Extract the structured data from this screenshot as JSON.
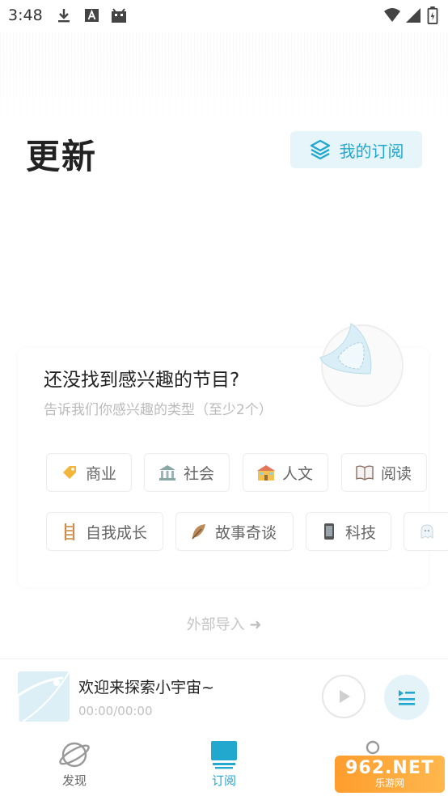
{
  "status_bar": {
    "time": "3:48",
    "left_icons": [
      "download-icon",
      "a-badge-icon",
      "android-icon"
    ],
    "right_icons": [
      "wifi-icon",
      "signal-icon",
      "battery-icon"
    ]
  },
  "header": {
    "title": "更新",
    "my_subscriptions_label": "我的订阅",
    "my_subscriptions_icon": "layers-icon"
  },
  "empty_state": {
    "title": "还没找到感兴趣的节目?",
    "subtitle": "告诉我们你感兴趣的类型（至少2个）",
    "illustration": "planet-icon"
  },
  "categories": [
    {
      "label": "商业",
      "icon": "price-tag-icon"
    },
    {
      "label": "社会",
      "icon": "classical-building-icon"
    },
    {
      "label": "人文",
      "icon": "school-icon"
    },
    {
      "label": "阅读",
      "icon": "open-book-icon"
    },
    {
      "label": "自我成长",
      "icon": "ladder-icon"
    },
    {
      "label": "故事奇谈",
      "icon": "feather-icon"
    },
    {
      "label": "科技",
      "icon": "mobile-phone-icon"
    },
    {
      "label": "",
      "icon": "ghost-icon"
    }
  ],
  "import_link": {
    "label": "外部导入",
    "icon": "arrow-right-icon"
  },
  "player": {
    "title": "欢迎来探索小宇宙~",
    "time": "00:00/00:00"
  },
  "bottom_nav": {
    "items": [
      {
        "label": "发现",
        "icon": "planet-nav-icon",
        "active": false
      },
      {
        "label": "订阅",
        "icon": "subscribe-nav-icon",
        "active": true
      },
      {
        "label": "",
        "icon": "person-icon",
        "active": false
      }
    ]
  },
  "watermark": {
    "big": "962.NET",
    "small": "乐游网"
  },
  "colors": {
    "accent": "#22a7cf",
    "accent_bg": "#e5f5fa",
    "muted_text": "#bbbbbb"
  }
}
